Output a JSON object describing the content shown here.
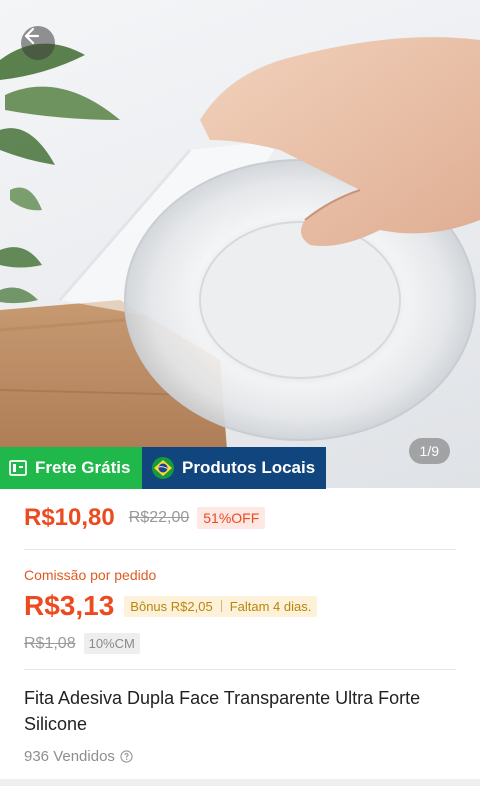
{
  "gallery": {
    "page_indicator": "1/9",
    "back_icon": "arrow-left-icon"
  },
  "badges": {
    "frete_label": "Frete Grátis",
    "frete_color": "#20b84b",
    "locais_label": "Produtos Locais",
    "locais_color": "#10457d"
  },
  "pricing": {
    "price": "R$10,80",
    "original_price": "R$22,00",
    "discount": "51%OFF",
    "accent_color": "#ec4a1f"
  },
  "commission": {
    "label": "Comissão por pedido",
    "value": "R$3,13",
    "bonus": "Bônus R$2,05",
    "deadline": "Faltam 4 dias.",
    "old_value": "R$1,08",
    "rate_badge": "10%CM"
  },
  "product": {
    "title": "Fita Adesiva Dupla Face Transparente Ultra Forte Silicone",
    "sold": "936 Vendidos"
  }
}
